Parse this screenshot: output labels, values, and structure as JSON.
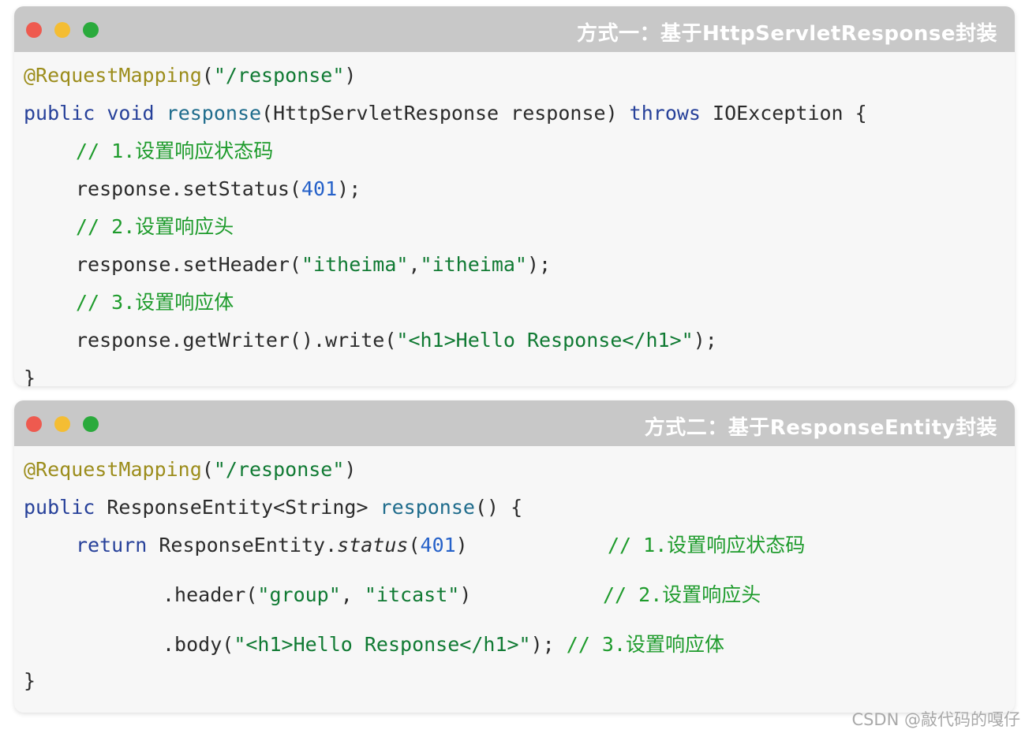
{
  "window1": {
    "title": "方式一：基于HttpServletResponse封装",
    "code": {
      "l1_annotation": "@RequestMapping",
      "l1_paren_open": "(",
      "l1_path": "\"/response\"",
      "l1_paren_close": ")",
      "l2_kw_public": "public",
      "l2_sp1": " ",
      "l2_kw_void": "void",
      "l2_sp2": " ",
      "l2_method": "response",
      "l2_params": "(HttpServletResponse response) ",
      "l2_kw_throws": "throws",
      "l2_rest": " IOException {",
      "l3_comment": "// 1.设置响应状态码",
      "l4_call": "response.setStatus(",
      "l4_num": "401",
      "l4_end": ");",
      "l5_comment": "// 2.设置响应头",
      "l6_call": "response.setHeader(",
      "l6_str1": "\"itheima\"",
      "l6_comma": ",",
      "l6_str2": "\"itheima\"",
      "l6_end": ");",
      "l7_comment": "// 3.设置响应体",
      "l8_call": "response.getWriter().write(",
      "l8_str": "\"<h1>Hello Response</h1>\"",
      "l8_end": ");",
      "l9_brace": "}"
    }
  },
  "window2": {
    "title": "方式二：基于ResponseEntity封装",
    "code": {
      "l1_annotation": "@RequestMapping",
      "l1_paren_open": "(",
      "l1_path": "\"/response\"",
      "l1_paren_close": ")",
      "l2_kw_public": "public",
      "l2_type": " ResponseEntity<String> ",
      "l2_method": "response",
      "l2_rest": "() {",
      "l3_kw_return": "return",
      "l3_class": " ResponseEntity.",
      "l3_status": "status",
      "l3_paren_open": "(",
      "l3_num": "401",
      "l3_paren_close": ")",
      "l3_comment": "// 1.设置响应状态码",
      "l4_call": ".header(",
      "l4_str1": "\"group\"",
      "l4_comma": ", ",
      "l4_str2": "\"itcast\"",
      "l4_end": ")",
      "l4_comment": "// 2.设置响应头",
      "l5_call": ".body(",
      "l5_str": "\"<h1>Hello Response</h1>\"",
      "l5_end": "); ",
      "l5_comment": "// 3.设置响应体",
      "l6_brace": "}"
    }
  },
  "watermark": "CSDN @敲代码的嘎仔",
  "colors": {
    "titlebar": "#c8c8c8",
    "close_dot": "#ee5a4f",
    "minimize_dot": "#f4bd33",
    "maximize_dot": "#2aaa3c",
    "keyword": "#27419a",
    "annotation": "#9c8d1c",
    "string": "#107a33",
    "comment": "#1e9b2c",
    "number": "#2561c9"
  }
}
